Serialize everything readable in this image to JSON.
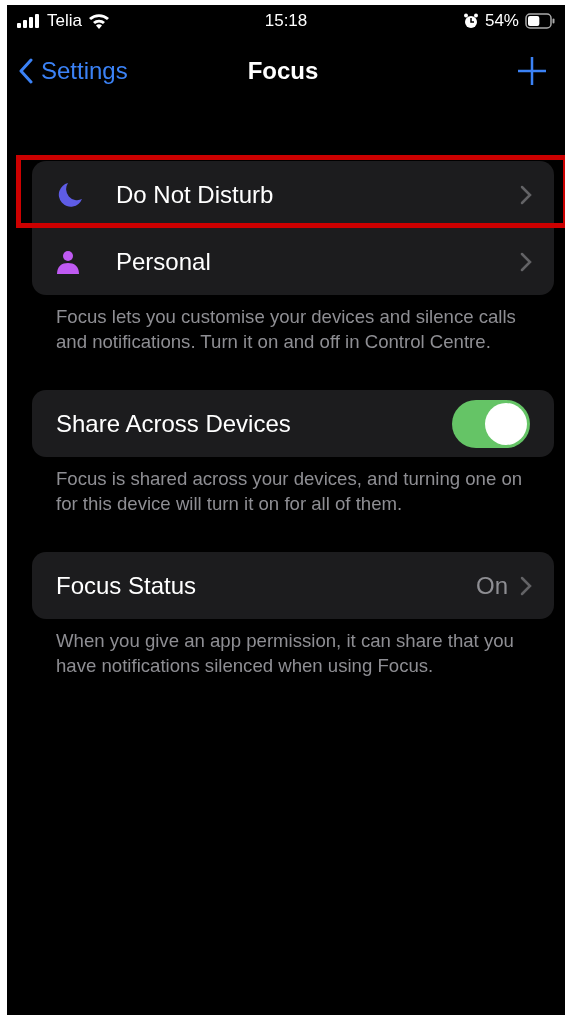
{
  "status_bar": {
    "carrier": "Telia",
    "time": "15:18",
    "battery": "54%",
    "alarm": true
  },
  "nav": {
    "back": "Settings",
    "title": "Focus"
  },
  "focus_modes": [
    {
      "label": "Do Not Disturb",
      "kind": "moon",
      "color": "#5e5ce6",
      "highlighted": true
    },
    {
      "label": "Personal",
      "kind": "person",
      "color": "#bf5af2",
      "highlighted": false
    }
  ],
  "focus_note": "Focus lets you customise your devices and silence calls and notifications. Turn it on and off in Control Centre.",
  "share": {
    "label": "Share Across Devices",
    "on": true
  },
  "share_note": "Focus is shared across your devices, and turning one on for this device will turn it on for all of them.",
  "status": {
    "label": "Focus Status",
    "value": "On"
  },
  "status_note": "When you give an app permission, it can share that you have notifications silenced when using Focus."
}
